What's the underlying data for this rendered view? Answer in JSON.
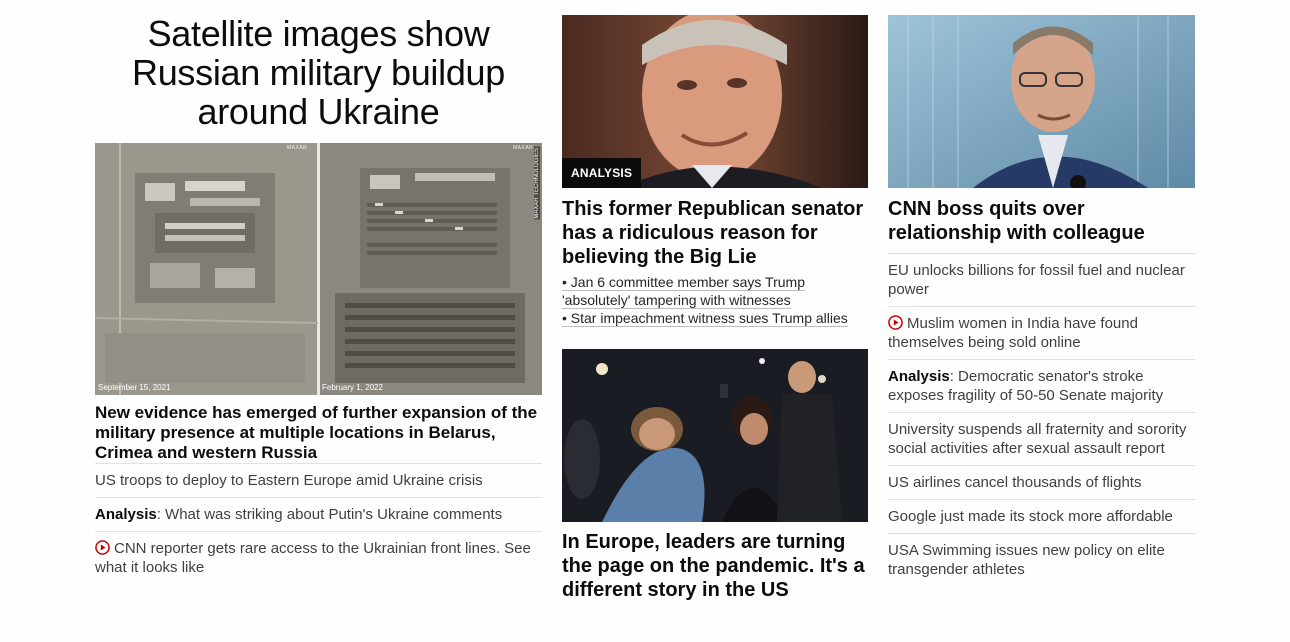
{
  "col1": {
    "hero_title": "Satellite images show Russian military buildup around Ukraine",
    "image": {
      "date_left": "September 15, 2021",
      "date_right": "February 1, 2022",
      "tag": "MAXAR",
      "credit": "MAXAR TECHNOLOGIES"
    },
    "lede": "New evidence has emerged of further expansion of the military presence at multiple locations in Belarus, Crimea and western Russia",
    "items": [
      {
        "text": "US troops to deploy to Eastern Europe amid Ukraine crisis"
      },
      {
        "prefix": "Analysis",
        "text": ": What was striking about Putin's Ukraine comments"
      },
      {
        "icon": "play-icon",
        "text": "CNN reporter gets rare access to the Ukrainian front lines. See what it looks like"
      }
    ]
  },
  "col2": {
    "story1": {
      "badge": "ANALYSIS",
      "headline": "This former Republican senator has a ridiculous reason for believing the Big Lie",
      "bullets": [
        "• Jan 6 committee member says Trump 'absolutely' tampering with witnesses",
        "• Star impeachment witness sues Trump allies"
      ]
    },
    "story2": {
      "headline": "In Europe, leaders are turning the page on the pandemic. It's a different story in the US"
    }
  },
  "col3": {
    "headline": "CNN boss quits over relationship with colleague",
    "items": [
      {
        "text": "EU unlocks billions for fossil fuel and nuclear power"
      },
      {
        "icon": "play-icon",
        "text": "Muslim women in India have found themselves being sold online"
      },
      {
        "prefix": "Analysis",
        "text": ": Democratic senator's stroke exposes fragility of 50-50 Senate majority"
      },
      {
        "text": "University suspends all fraternity and sorority social activities after sexual assault report"
      },
      {
        "text": "US airlines cancel thousands of flights"
      },
      {
        "text": "Google just made its stock more affordable"
      },
      {
        "text": "USA Swimming issues new policy on elite transgender athletes"
      }
    ]
  },
  "colors": {
    "play_red": "#cc0000",
    "badge_bg": "#0c0c0c",
    "divider": "#e2e2e2"
  }
}
